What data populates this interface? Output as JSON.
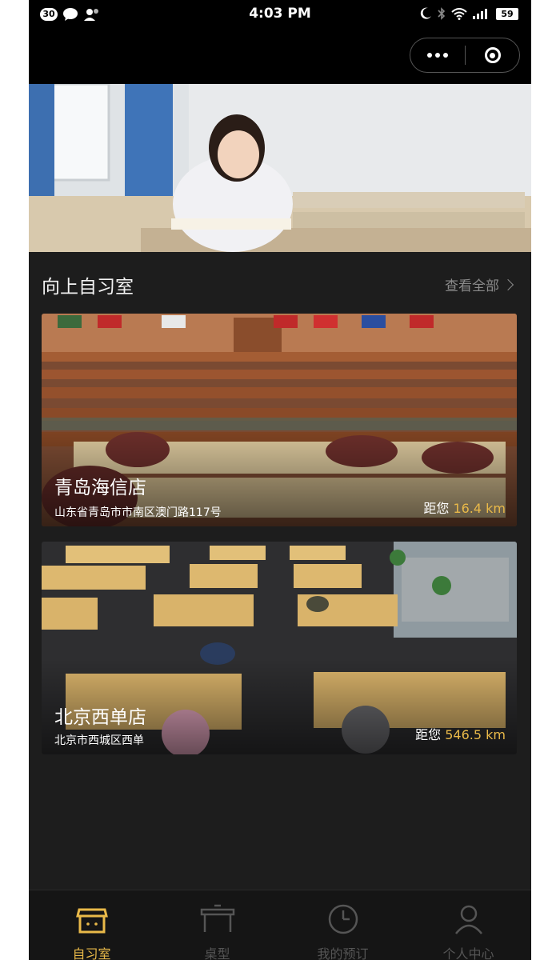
{
  "status_bar": {
    "notification_count": "30",
    "time": "4:03 PM",
    "battery": "59"
  },
  "section": {
    "title": "向上自习室",
    "view_all": "查看全部"
  },
  "stores": [
    {
      "name": "青岛海信店",
      "address": "山东省青岛市市南区澳门路117号",
      "distance_prefix": "距您",
      "distance": "16.4 km"
    },
    {
      "name": "北京西单店",
      "address": "北京市西城区西单",
      "distance_prefix": "距您",
      "distance": "546.5 km"
    }
  ],
  "tabs": [
    {
      "label": "自习室",
      "icon": "store-icon",
      "active": true
    },
    {
      "label": "桌型",
      "icon": "desk-icon",
      "active": false
    },
    {
      "label": "我的预订",
      "icon": "clock-icon",
      "active": false
    },
    {
      "label": "个人中心",
      "icon": "user-icon",
      "active": false
    }
  ],
  "colors": {
    "accent": "#e9b949",
    "background": "#1d1d1d",
    "tabbar": "#151515"
  }
}
